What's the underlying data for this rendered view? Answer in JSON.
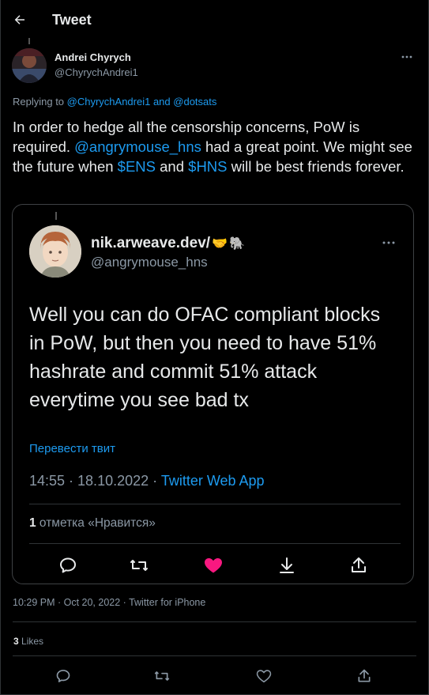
{
  "header": {
    "title": "Tweet",
    "back_icon": "arrow-left-icon"
  },
  "tweet": {
    "author": {
      "name": "Andrei Chyrych",
      "handle": "@ChyrychAndrei1"
    },
    "replying_prefix": "Replying to ",
    "replying_to": [
      "@ChyrychAndrei1",
      "@dotsats"
    ],
    "replying_and": " and ",
    "text_parts": {
      "p1": "In order to hedge all the censorship concerns, PoW is required. ",
      "mention": "@angrymouse_hns",
      "p2": " had a great point. We might see the future when ",
      "cashtag1": "$ENS",
      "p3": " and ",
      "cashtag2": "$HNS",
      "p4": " will be best friends forever."
    },
    "timestamp": "10:29 PM · Oct 20, 2022 · Twitter for iPhone",
    "likes_count": "3",
    "likes_label": " Likes"
  },
  "quote": {
    "name": "nik.arweave.dev/",
    "emoji_handshake": "🤝",
    "emoji_elephant": "🐘",
    "handle": "@angrymouse_hns",
    "text": "Well you can do OFAC compliant blocks in PoW, but then you need to have 51% hashrate and commit 51% attack everytime you see bad tx",
    "translate": "Перевести твит",
    "meta_time": "14:55 · 18.10.2022 · ",
    "meta_source": "Twitter Web App",
    "likes_count": "1",
    "likes_label": " отметка «Нравится»"
  },
  "colors": {
    "accent": "#1d9bf0",
    "like": "#f91880",
    "muted": "#8b98a5",
    "text": "#e7e9ea"
  }
}
